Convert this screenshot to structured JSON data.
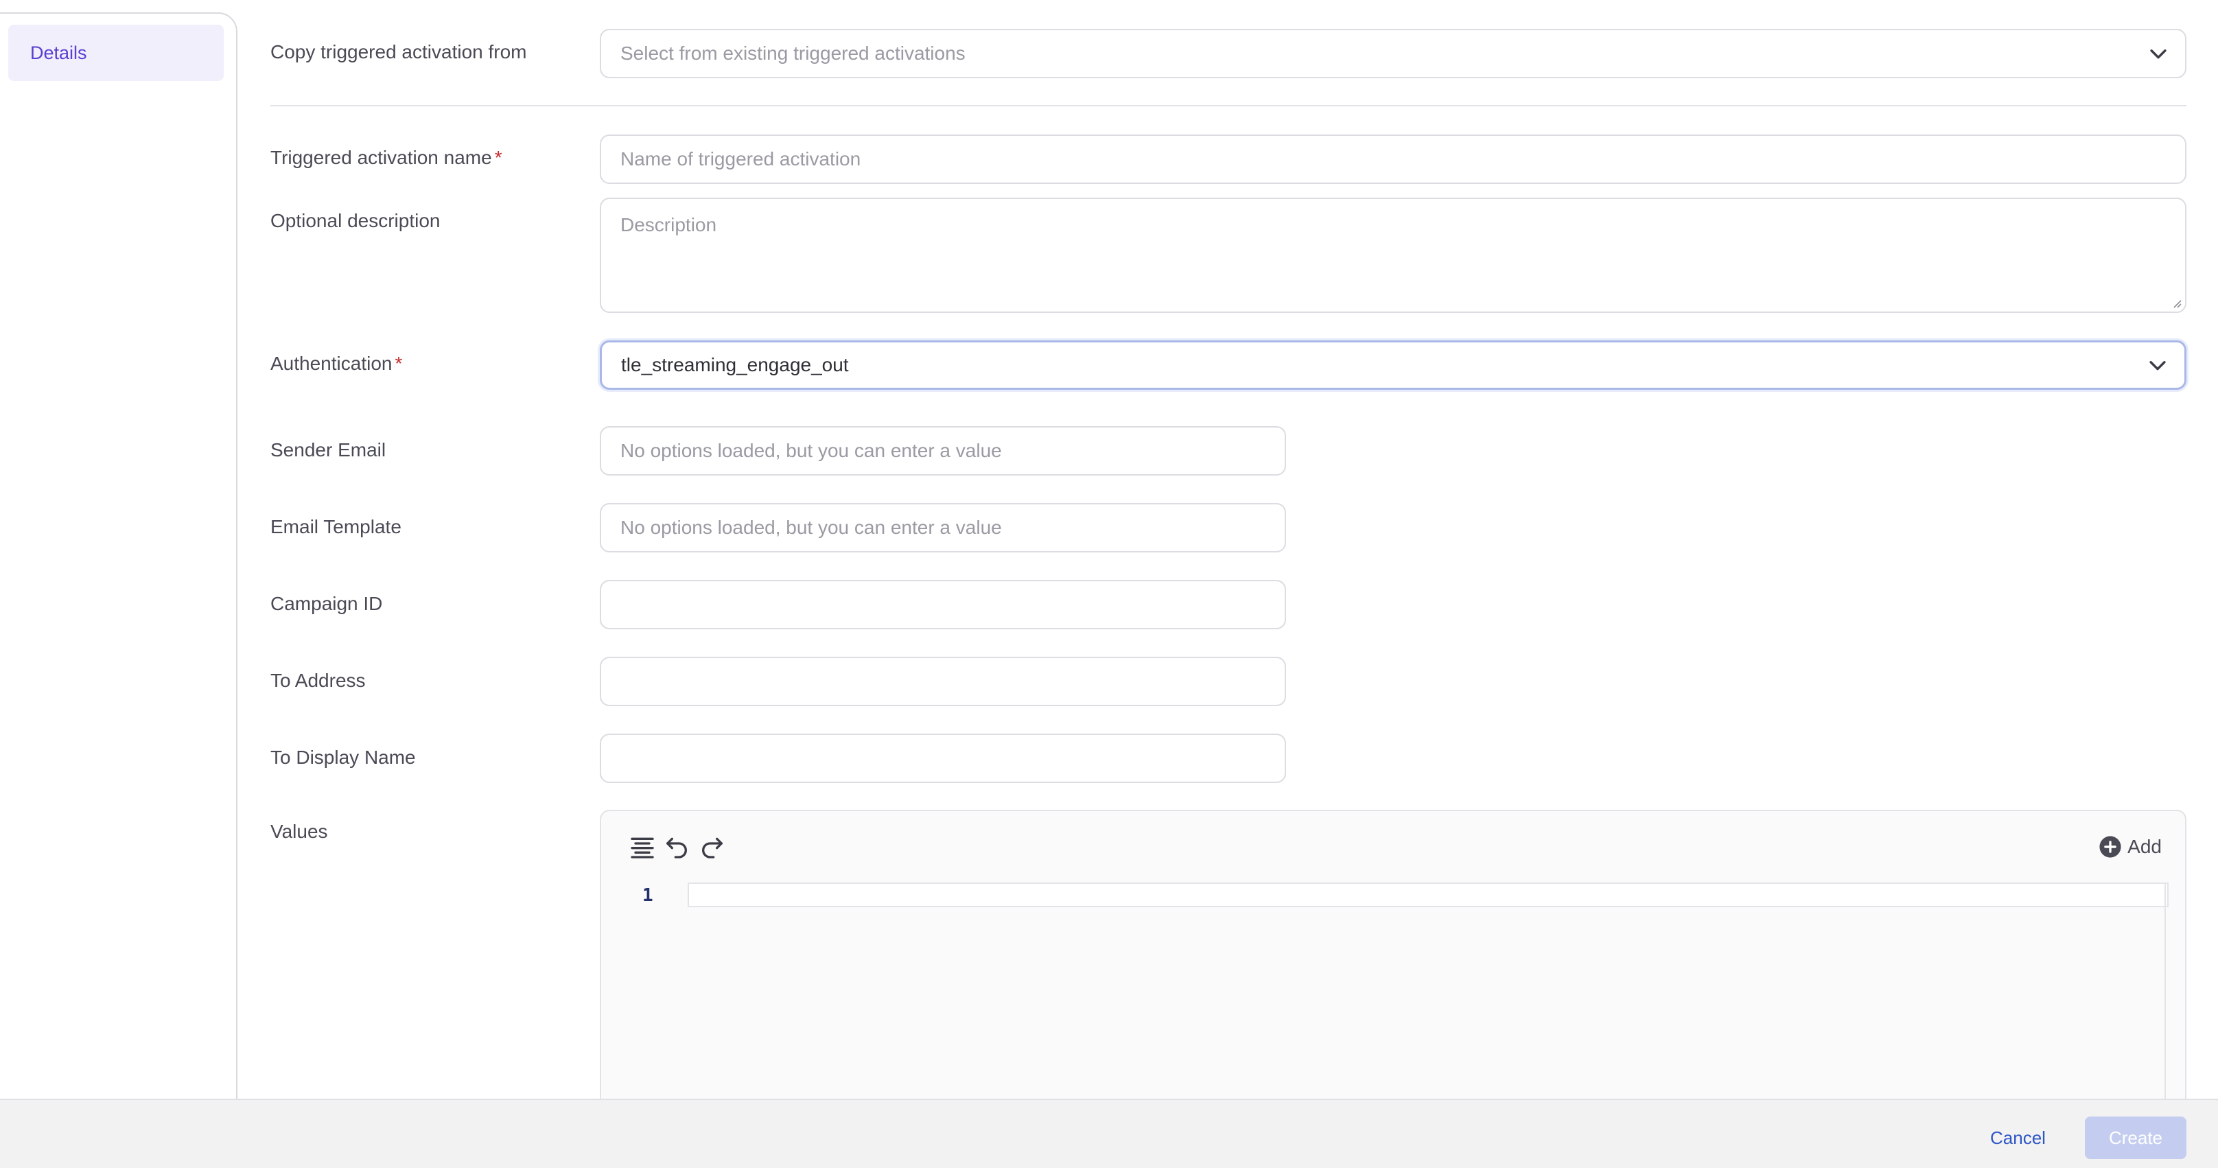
{
  "sidebar": {
    "items": [
      {
        "label": "Details",
        "active": true
      }
    ]
  },
  "form": {
    "copy_from": {
      "label": "Copy triggered activation from",
      "placeholder": "Select from existing triggered activations"
    },
    "name": {
      "label": "Triggered activation name",
      "required_mark": "*",
      "placeholder": "Name of triggered activation"
    },
    "description": {
      "label": "Optional description",
      "placeholder": "Description"
    },
    "authentication": {
      "label": "Authentication",
      "required_mark": "*",
      "value": "tle_streaming_engage_out"
    },
    "sender_email": {
      "label": "Sender Email",
      "placeholder": "No options loaded, but you can enter a value"
    },
    "email_template": {
      "label": "Email Template",
      "placeholder": "No options loaded, but you can enter a value"
    },
    "campaign_id": {
      "label": "Campaign ID",
      "value": ""
    },
    "to_address": {
      "label": "To Address",
      "value": ""
    },
    "to_display_name": {
      "label": "To Display Name",
      "value": ""
    },
    "values": {
      "label": "Values",
      "add_label": "Add",
      "line_number": "1",
      "toolbar_icons": [
        "format-icon",
        "undo-icon",
        "redo-icon"
      ]
    }
  },
  "footer": {
    "cancel_label": "Cancel",
    "create_label": "Create"
  },
  "colors": {
    "accent": "#5a3fd1",
    "link": "#2f56c5",
    "create_disabled": "#c4cdef",
    "required": "#c62828"
  }
}
